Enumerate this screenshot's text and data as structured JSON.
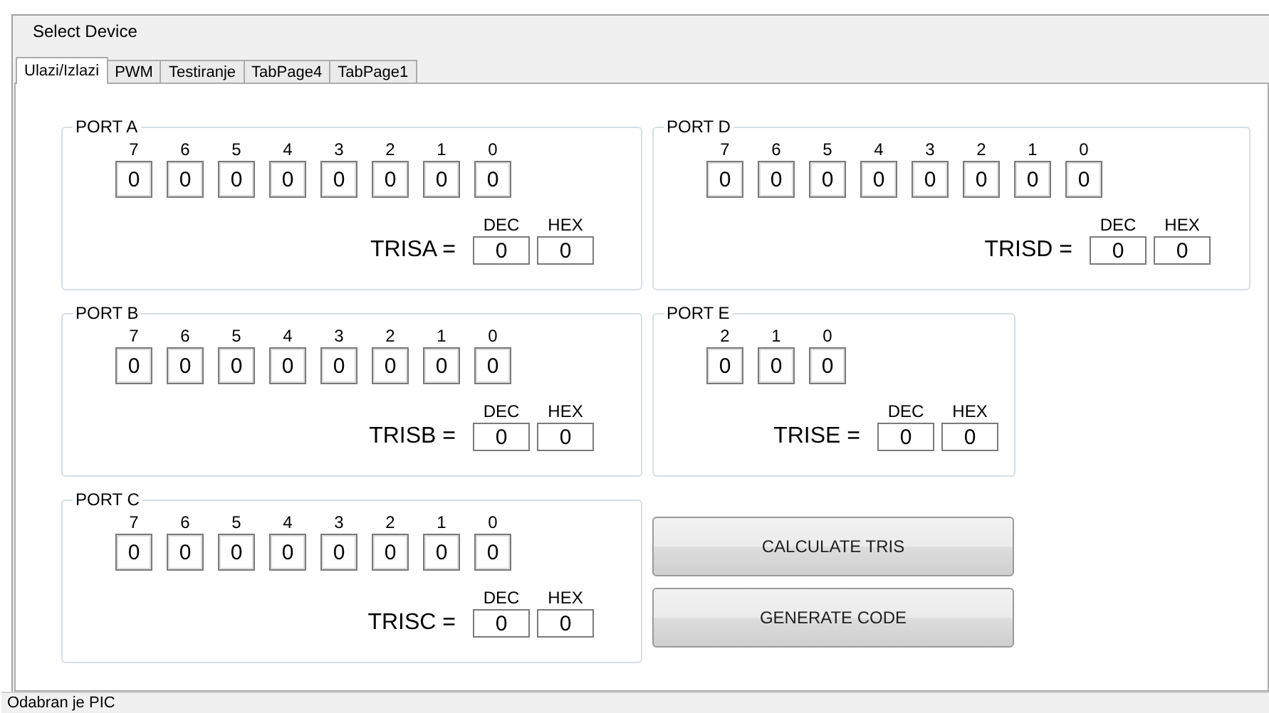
{
  "menu": {
    "items": [
      {
        "label": "Select Device"
      }
    ]
  },
  "tabs": [
    {
      "label": "Ulazi/Izlazi",
      "selected": true
    },
    {
      "label": "PWM",
      "selected": false
    },
    {
      "label": "Testiranje",
      "selected": false
    },
    {
      "label": "TabPage4",
      "selected": false
    },
    {
      "label": "TabPage1",
      "selected": false
    }
  ],
  "ports": [
    {
      "title": "PORT A",
      "bits": [
        {
          "label": "7",
          "value": "0"
        },
        {
          "label": "6",
          "value": "0"
        },
        {
          "label": "5",
          "value": "0"
        },
        {
          "label": "4",
          "value": "0"
        },
        {
          "label": "3",
          "value": "0"
        },
        {
          "label": "2",
          "value": "0"
        },
        {
          "label": "1",
          "value": "0"
        },
        {
          "label": "0",
          "value": "0"
        }
      ],
      "tris_label": "TRISA =",
      "dec_label": "DEC",
      "hex_label": "HEX",
      "dec": "0",
      "hex": "0"
    },
    {
      "title": "PORT D",
      "bits": [
        {
          "label": "7",
          "value": "0"
        },
        {
          "label": "6",
          "value": "0"
        },
        {
          "label": "5",
          "value": "0"
        },
        {
          "label": "4",
          "value": "0"
        },
        {
          "label": "3",
          "value": "0"
        },
        {
          "label": "2",
          "value": "0"
        },
        {
          "label": "1",
          "value": "0"
        },
        {
          "label": "0",
          "value": "0"
        }
      ],
      "tris_label": "TRISD =",
      "dec_label": "DEC",
      "hex_label": "HEX",
      "dec": "0",
      "hex": "0"
    },
    {
      "title": "PORT B",
      "bits": [
        {
          "label": "7",
          "value": "0"
        },
        {
          "label": "6",
          "value": "0"
        },
        {
          "label": "5",
          "value": "0"
        },
        {
          "label": "4",
          "value": "0"
        },
        {
          "label": "3",
          "value": "0"
        },
        {
          "label": "2",
          "value": "0"
        },
        {
          "label": "1",
          "value": "0"
        },
        {
          "label": "0",
          "value": "0"
        }
      ],
      "tris_label": "TRISB =",
      "dec_label": "DEC",
      "hex_label": "HEX",
      "dec": "0",
      "hex": "0"
    },
    {
      "title": "PORT E",
      "bits": [
        {
          "label": "2",
          "value": "0"
        },
        {
          "label": "1",
          "value": "0"
        },
        {
          "label": "0",
          "value": "0"
        }
      ],
      "tris_label": "TRISE =",
      "dec_label": "DEC",
      "hex_label": "HEX",
      "dec": "0",
      "hex": "0"
    },
    {
      "title": "PORT C",
      "bits": [
        {
          "label": "7",
          "value": "0"
        },
        {
          "label": "6",
          "value": "0"
        },
        {
          "label": "5",
          "value": "0"
        },
        {
          "label": "4",
          "value": "0"
        },
        {
          "label": "3",
          "value": "0"
        },
        {
          "label": "2",
          "value": "0"
        },
        {
          "label": "1",
          "value": "0"
        },
        {
          "label": "0",
          "value": "0"
        }
      ],
      "tris_label": "TRISC =",
      "dec_label": "DEC",
      "hex_label": "HEX",
      "dec": "0",
      "hex": "0"
    }
  ],
  "buttons": [
    {
      "label": "CALCULATE TRIS"
    },
    {
      "label": "GENERATE CODE"
    }
  ],
  "status_bar": {
    "text": "Odabran je PIC"
  }
}
